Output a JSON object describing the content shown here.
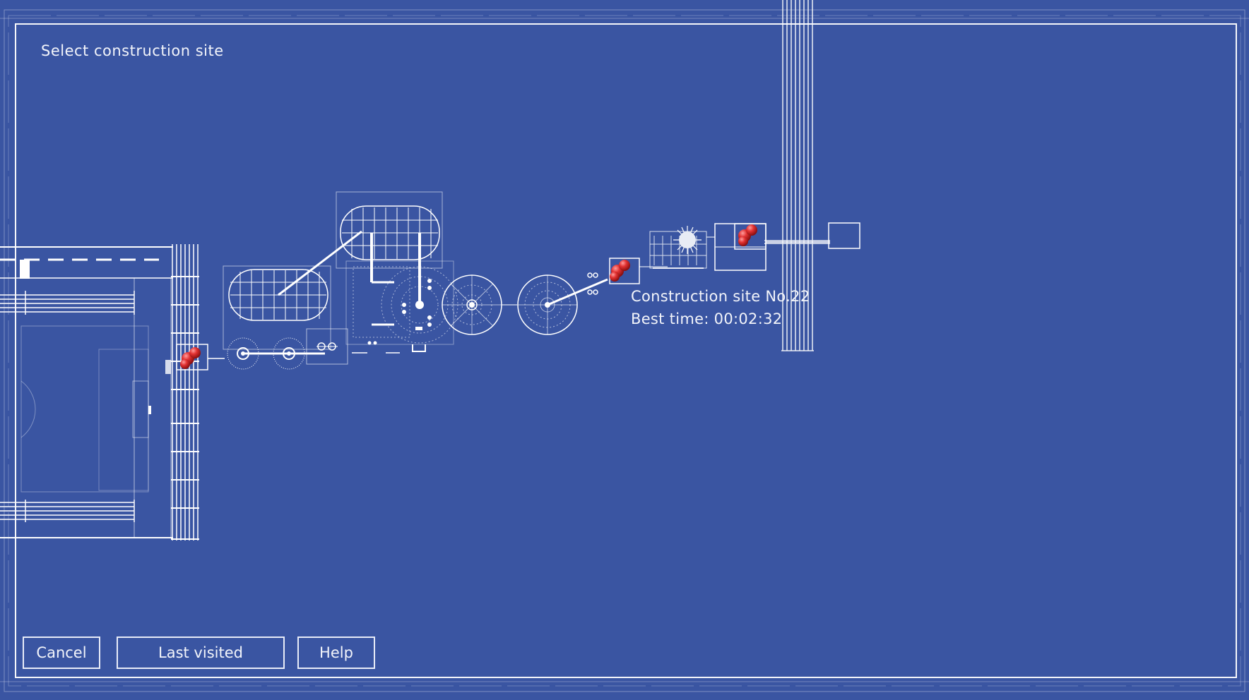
{
  "screen": {
    "title": "Select construction site"
  },
  "selected_site": {
    "name": "Construction site No.22",
    "best_time_label": "Best time: 00:02:32"
  },
  "buttons": {
    "cancel": "Cancel",
    "last_visited": "Last visited",
    "help": "Help"
  },
  "colors": {
    "background": "#3a55a2",
    "lines": "#ffffff",
    "pin": "#d42a2a"
  },
  "pins": [
    {
      "id": "site-pin-1"
    },
    {
      "id": "site-pin-2"
    },
    {
      "id": "site-pin-3"
    }
  ]
}
